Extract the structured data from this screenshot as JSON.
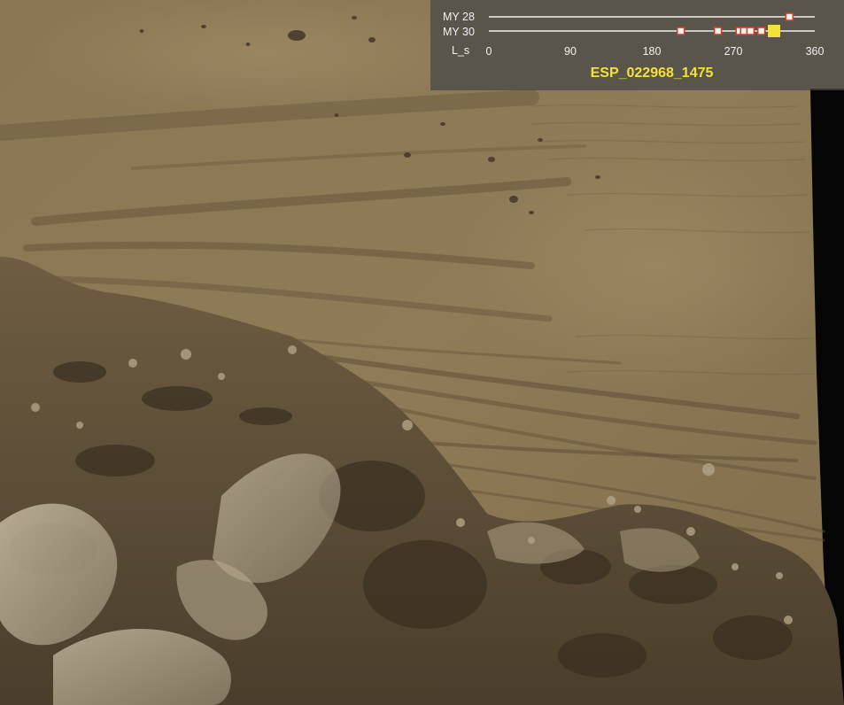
{
  "overlay": {
    "rows": [
      {
        "label": "MY 28",
        "markers": [
          {
            "ls": 332,
            "kind": "observation"
          }
        ]
      },
      {
        "label": "MY 30",
        "markers": [
          {
            "ls": 212,
            "kind": "observation"
          },
          {
            "ls": 253,
            "kind": "observation"
          },
          {
            "ls": 277,
            "kind": "observation"
          },
          {
            "ls": 282,
            "kind": "observation"
          },
          {
            "ls": 289,
            "kind": "observation"
          },
          {
            "ls": 301,
            "kind": "observation"
          },
          {
            "ls": 315,
            "kind": "current"
          }
        ]
      }
    ],
    "axis_label": "L_s",
    "axis_ticks": [
      "0",
      "90",
      "180",
      "270",
      "360"
    ],
    "axis_range": [
      0,
      360
    ],
    "observation_id": "ESP_022968_1475"
  },
  "colors": {
    "observation_marker_fill": "#f4f0ea",
    "observation_marker_border": "#c8402e",
    "current_marker": "#f2e33a",
    "observation_id_text": "#f2e33a",
    "terrain_base": "#8f7c58"
  }
}
